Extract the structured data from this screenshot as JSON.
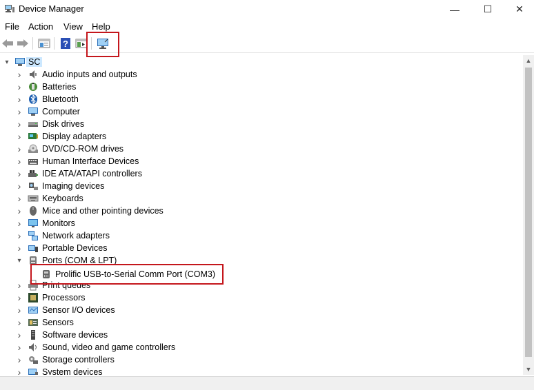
{
  "window": {
    "title": "Device Manager",
    "minimize": "—",
    "maximize": "☐",
    "close": "✕"
  },
  "menu": {
    "file": "File",
    "action": "Action",
    "view": "View",
    "help": "Help"
  },
  "toolbar": {
    "back_icon": "arrow-left-icon",
    "forward_icon": "arrow-right-icon",
    "properties_icon": "properties-icon",
    "help_icon": "help-icon",
    "show_hide_icon": "console-tree-icon",
    "scan_icon": "scan-hardware-monitor-icon"
  },
  "tree": {
    "root": {
      "label": "SC",
      "expanded": true
    },
    "categories": [
      {
        "label": "Audio inputs and outputs",
        "icon": "speaker-icon"
      },
      {
        "label": "Batteries",
        "icon": "battery-icon"
      },
      {
        "label": "Bluetooth",
        "icon": "bluetooth-icon"
      },
      {
        "label": "Computer",
        "icon": "computer-icon"
      },
      {
        "label": "Disk drives",
        "icon": "disk-drive-icon"
      },
      {
        "label": "Display adapters",
        "icon": "display-adapter-icon"
      },
      {
        "label": "DVD/CD-ROM drives",
        "icon": "dvd-icon"
      },
      {
        "label": "Human Interface Devices",
        "icon": "hid-icon"
      },
      {
        "label": "IDE ATA/ATAPI controllers",
        "icon": "ide-controller-icon"
      },
      {
        "label": "Imaging devices",
        "icon": "camera-icon"
      },
      {
        "label": "Keyboards",
        "icon": "keyboard-icon"
      },
      {
        "label": "Mice and other pointing devices",
        "icon": "mouse-icon"
      },
      {
        "label": "Monitors",
        "icon": "monitor-icon"
      },
      {
        "label": "Network adapters",
        "icon": "network-adapter-icon"
      },
      {
        "label": "Portable Devices",
        "icon": "portable-device-icon"
      },
      {
        "label": "Ports (COM & LPT)",
        "icon": "port-icon",
        "expanded": true,
        "children": [
          {
            "label": "Prolific USB-to-Serial Comm Port (COM3)",
            "icon": "serial-port-icon"
          }
        ]
      },
      {
        "label": "Print queues",
        "icon": "printer-icon"
      },
      {
        "label": "Processors",
        "icon": "processor-icon"
      },
      {
        "label": "Sensor I/O devices",
        "icon": "sensor-io-icon"
      },
      {
        "label": "Sensors",
        "icon": "sensor-icon"
      },
      {
        "label": "Software devices",
        "icon": "software-device-icon"
      },
      {
        "label": "Sound, video and game controllers",
        "icon": "sound-controller-icon"
      },
      {
        "label": "Storage controllers",
        "icon": "storage-controller-icon"
      },
      {
        "label": "System devices",
        "icon": "system-device-icon"
      }
    ]
  },
  "colors": {
    "highlight": "#c4161c",
    "selection_root": "#cce8ff"
  }
}
